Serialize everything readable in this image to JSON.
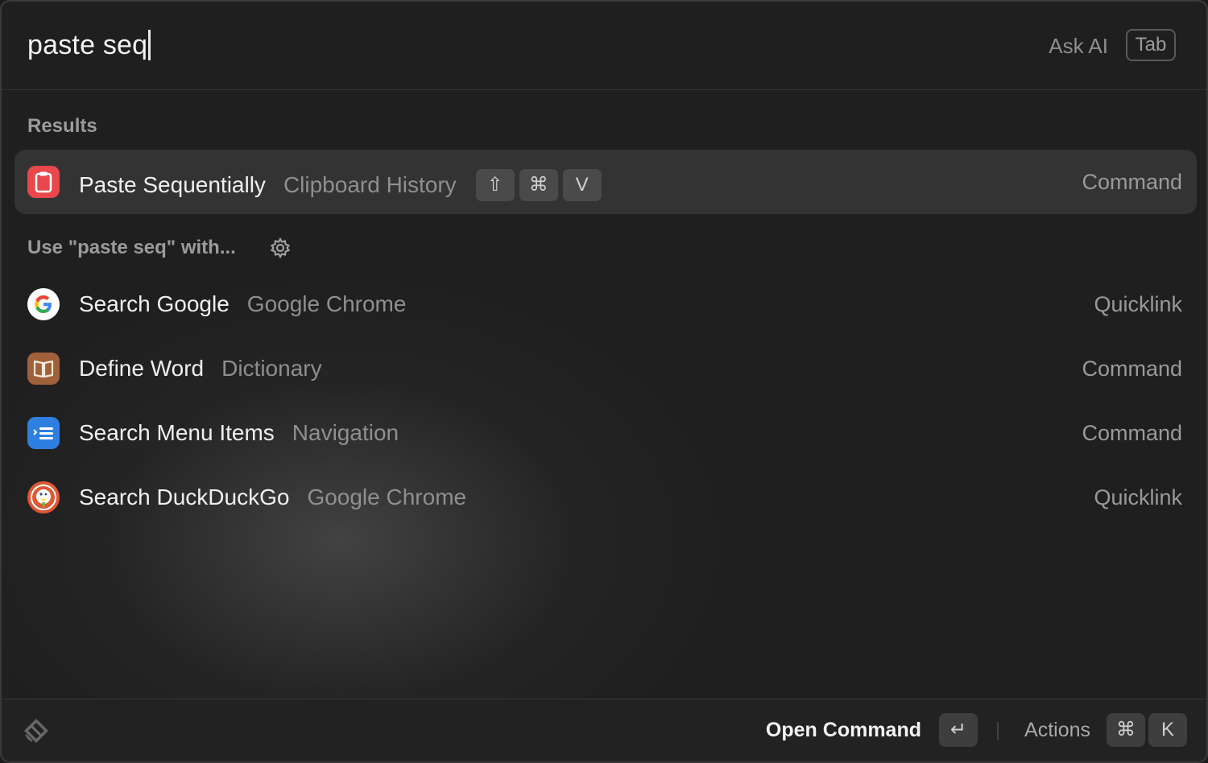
{
  "search": {
    "query": "paste seq",
    "ask_ai_label": "Ask AI",
    "ask_ai_key": "Tab"
  },
  "results": {
    "section_title": "Results",
    "items": [
      {
        "title": "Paste Sequentially",
        "subtitle": "Clipboard History",
        "shortcut": [
          "⇧",
          "⌘",
          "V"
        ],
        "kind": "Command",
        "icon": "clipboard-icon",
        "selected": true
      }
    ]
  },
  "fallback": {
    "section_title": "Use \"paste seq\" with...",
    "settings_icon": "gear-icon",
    "items": [
      {
        "title": "Search Google",
        "subtitle": "Google Chrome",
        "kind": "Quicklink",
        "icon": "google-icon"
      },
      {
        "title": "Define Word",
        "subtitle": "Dictionary",
        "kind": "Command",
        "icon": "dictionary-book-icon"
      },
      {
        "title": "Search Menu Items",
        "subtitle": "Navigation",
        "kind": "Command",
        "icon": "menu-list-icon"
      },
      {
        "title": "Search DuckDuckGo",
        "subtitle": "Google Chrome",
        "kind": "Quicklink",
        "icon": "duckduckgo-icon"
      }
    ]
  },
  "footer": {
    "logo_icon": "raycast-logo-icon",
    "primary_action": "Open Command",
    "primary_key": "↵",
    "actions_label": "Actions",
    "actions_keys": [
      "⌘",
      "K"
    ]
  },
  "colors": {
    "background": "#1f1f1f",
    "selected_row": "#333333",
    "clipboard_red": "#e8474b",
    "dictionary_brown": "#a0603a",
    "menu_blue": "#2f7fe0",
    "duckduckgo_orange": "#de5833"
  }
}
